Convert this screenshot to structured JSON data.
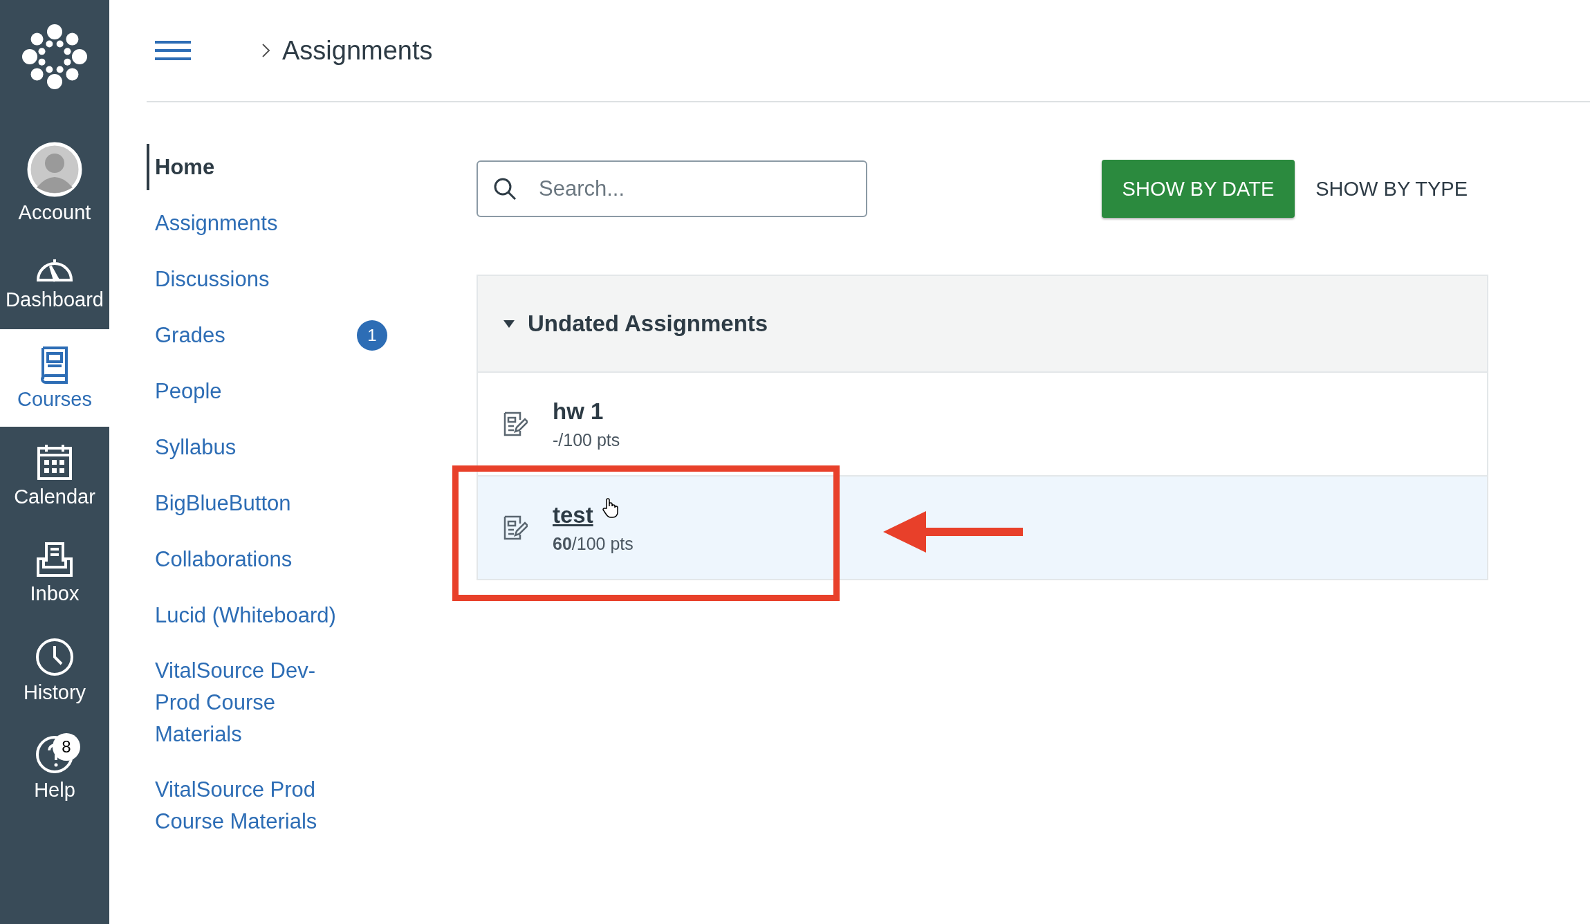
{
  "global_nav": [
    {
      "label": "Account",
      "kind": "account",
      "selected": false
    },
    {
      "label": "Dashboard",
      "kind": "dashboard",
      "selected": false
    },
    {
      "label": "Courses",
      "kind": "courses",
      "selected": true
    },
    {
      "label": "Calendar",
      "kind": "calendar",
      "selected": false
    },
    {
      "label": "Inbox",
      "kind": "inbox",
      "selected": false
    },
    {
      "label": "History",
      "kind": "history",
      "selected": false
    },
    {
      "label": "Help",
      "kind": "help",
      "selected": false,
      "badge": "8"
    }
  ],
  "breadcrumb": {
    "current": "Assignments"
  },
  "course_nav": [
    {
      "label": "Home",
      "selected": true
    },
    {
      "label": "Assignments",
      "selected": false
    },
    {
      "label": "Discussions",
      "selected": false
    },
    {
      "label": "Grades",
      "selected": false,
      "badge": "1"
    },
    {
      "label": "People",
      "selected": false
    },
    {
      "label": "Syllabus",
      "selected": false
    },
    {
      "label": "BigBlueButton",
      "selected": false
    },
    {
      "label": "Collaborations",
      "selected": false
    },
    {
      "label": "Lucid (Whiteboard)",
      "selected": false
    },
    {
      "label": "VitalSource Dev-Prod Course Materials",
      "selected": false
    },
    {
      "label": "VitalSource Prod Course Materials",
      "selected": false
    }
  ],
  "search": {
    "placeholder": "Search..."
  },
  "view_buttons": [
    {
      "label": "SHOW BY DATE",
      "selected": true
    },
    {
      "label": "SHOW BY TYPE",
      "selected": false
    }
  ],
  "group": {
    "title": "Undated Assignments",
    "expanded": true,
    "assignments": [
      {
        "title": "hw 1",
        "points": "-/100 pts",
        "hovered": false,
        "highlighted": false
      },
      {
        "title": "test",
        "points": "**60**/100 pts",
        "hovered": true,
        "highlighted": true
      }
    ]
  }
}
